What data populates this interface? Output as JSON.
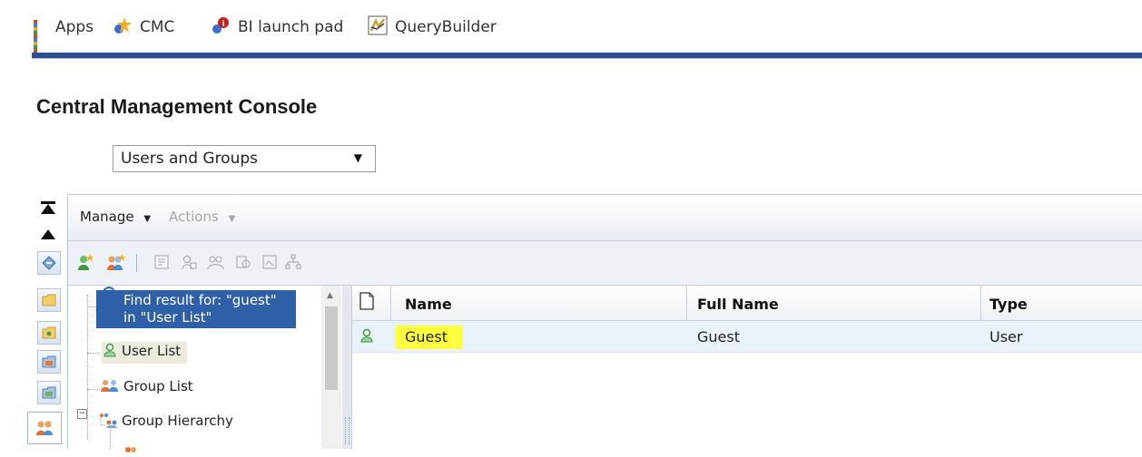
{
  "bookmarks": [
    {
      "label": "Apps",
      "icon": "apps-grid-icon"
    },
    {
      "label": "CMC",
      "icon": "cmc-icon"
    },
    {
      "label": "BI launch pad",
      "icon": "bi-launchpad-icon"
    },
    {
      "label": "QueryBuilder",
      "icon": "querybuilder-icon"
    }
  ],
  "page": {
    "title": "Central Management Console",
    "view_select": "Users and Groups"
  },
  "menu": {
    "manage": "Manage",
    "actions": "Actions"
  },
  "tree": {
    "find_result": "Find result for: \"guest\" in \"User List\"",
    "items": [
      "User List",
      "Group List",
      "Group Hierarchy"
    ]
  },
  "table": {
    "columns": [
      "Name",
      "Full Name",
      "Type"
    ],
    "rows": [
      {
        "name": "Guest",
        "full_name": "Guest",
        "type": "User"
      }
    ]
  },
  "colors": {
    "accent_bar": "#2c4f92",
    "selection": "#2f5fa7",
    "highlight": "#ffff3d"
  }
}
